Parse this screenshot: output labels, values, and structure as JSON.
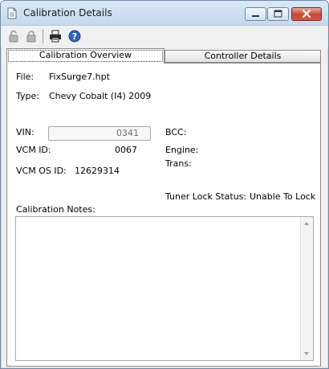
{
  "window": {
    "title": "Calibration Details"
  },
  "toolbar": {
    "icons": [
      "unlock-icon",
      "lock-icon",
      "print-icon",
      "help-icon"
    ]
  },
  "tabs": [
    {
      "label": "Calibration Overview",
      "active": true
    },
    {
      "label": "Controller Details",
      "active": false
    }
  ],
  "overview": {
    "file_label": "File:",
    "file_value": "FixSurge7.hpt",
    "type_label": "Type:",
    "type_value": "Chevy Cobalt (I4) 2009",
    "vin_label": "VIN:",
    "vin_value": "0341",
    "bcc_label": "BCC:",
    "vcm_id_label": "VCM ID:",
    "vcm_id_value": "0067",
    "engine_label": "Engine:",
    "trans_label": "Trans:",
    "vcm_os_label": "VCM OS ID:",
    "vcm_os_value": "12629314",
    "tuner_lock_label": "Tuner Lock Status:",
    "tuner_lock_value": "Unable To Lock",
    "notes_label": "Calibration Notes:",
    "notes_value": ""
  },
  "colors": {
    "titlebar": "#c9dcf0",
    "close_button": "#c9452f",
    "panel_bg": "#ffffff",
    "chrome_bg": "#f0f0f0"
  }
}
